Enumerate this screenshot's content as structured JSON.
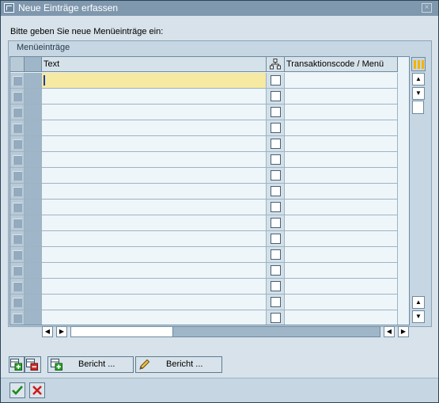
{
  "window": {
    "title": "Neue Einträge erfassen",
    "close_glyph": "×"
  },
  "instruction": "Bitte geben Sie neue Menüeinträge ein:",
  "group": {
    "title": "Menüeinträge"
  },
  "table": {
    "columns": [
      "Text",
      "",
      "Transaktionscode / Menü"
    ],
    "row_count": 16,
    "active_row": 0,
    "rows": [
      {
        "text": "",
        "checked": false,
        "transaction": ""
      },
      {
        "text": "",
        "checked": false,
        "transaction": ""
      },
      {
        "text": "",
        "checked": false,
        "transaction": ""
      },
      {
        "text": "",
        "checked": false,
        "transaction": ""
      },
      {
        "text": "",
        "checked": false,
        "transaction": ""
      },
      {
        "text": "",
        "checked": false,
        "transaction": ""
      },
      {
        "text": "",
        "checked": false,
        "transaction": ""
      },
      {
        "text": "",
        "checked": false,
        "transaction": ""
      },
      {
        "text": "",
        "checked": false,
        "transaction": ""
      },
      {
        "text": "",
        "checked": false,
        "transaction": ""
      },
      {
        "text": "",
        "checked": false,
        "transaction": ""
      },
      {
        "text": "",
        "checked": false,
        "transaction": ""
      },
      {
        "text": "",
        "checked": false,
        "transaction": ""
      },
      {
        "text": "",
        "checked": false,
        "transaction": ""
      },
      {
        "text": "",
        "checked": false,
        "transaction": ""
      },
      {
        "text": "",
        "checked": false,
        "transaction": ""
      }
    ]
  },
  "buttons": {
    "insert_row_icon": "insert-row-icon",
    "delete_row_icon": "delete-row-icon",
    "report_add_label": "Bericht ...",
    "report_add_icon": "insert-report-icon",
    "report_edit_label": "Bericht ...",
    "report_edit_icon": "pencil-icon",
    "confirm_icon": "checkmark-icon",
    "cancel_icon": "cancel-x-icon"
  },
  "colors": {
    "titlebar": "#7f98ae",
    "active_cell": "#f6e9a2",
    "confirm_green": "#1a8a1a",
    "cancel_red": "#d11a1a"
  }
}
